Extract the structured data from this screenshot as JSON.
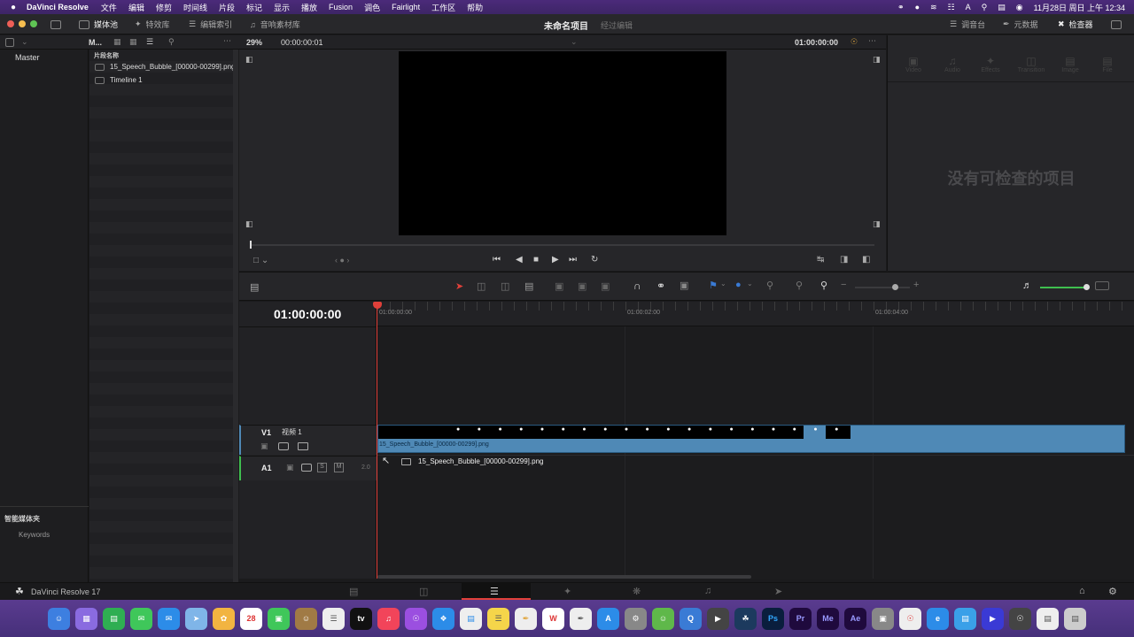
{
  "menubar": {
    "apple": "",
    "app_name": "DaVinci Resolve",
    "items": [
      "文件",
      "编辑",
      "修剪",
      "时间线",
      "片段",
      "标记",
      "显示",
      "播放",
      "Fusion",
      "调色",
      "Fairlight",
      "工作区",
      "帮助"
    ],
    "datetime": "11月28日 周日 上午 12:34"
  },
  "toolbar": {
    "media_pool": "媒体池",
    "effects_library": "特效库",
    "edit_index": "编辑索引",
    "sound_library": "音响素材库",
    "project_title": "未命名项目",
    "project_subtitle": "经过编辑",
    "mixer": "调音台",
    "metadata": "元数据",
    "inspector": "检查器"
  },
  "subbar": {
    "bin_label": "M...",
    "zoom": "29%",
    "source_timecode": "00:00:00:01",
    "record_timecode": "01:00:00:00"
  },
  "bins": {
    "master": "Master",
    "smart_bins": "智能媒体夹",
    "keywords": "Keywords"
  },
  "media_list": {
    "column_header": "片段名称",
    "items": [
      {
        "name": "15_Speech_Bubble_[00000-00299].png"
      },
      {
        "name": "Timeline 1"
      }
    ]
  },
  "inspector": {
    "tabs": [
      "Video",
      "Audio",
      "Effects",
      "Transition",
      "Image",
      "File"
    ],
    "empty_message": "没有可检查的项目"
  },
  "timeline": {
    "current_timecode": "01:00:00:00",
    "ruler": [
      "01:00:00:00",
      "01:00:02:00",
      "01:00:04:00"
    ],
    "video_track": {
      "id": "V1",
      "name": "视频 1",
      "clip": "15_Speech_Bubble_[00000-00299].png"
    },
    "audio_track": {
      "id": "A1",
      "solo": "S",
      "mute": "M",
      "level": "2.0",
      "clip": "15_Speech_Bubble_[00000-00299].png"
    }
  },
  "bottombar": {
    "app_label": "DaVinci Resolve 17"
  },
  "dock": {
    "calendar_day": "28",
    "apps": [
      "Ps",
      "Pr",
      "Me",
      "Ae"
    ],
    "tv": "tv"
  },
  "colors": {
    "accent_red": "#e0403a",
    "clip_blue": "#4f89b6",
    "menubar": "#4b2a7a"
  }
}
